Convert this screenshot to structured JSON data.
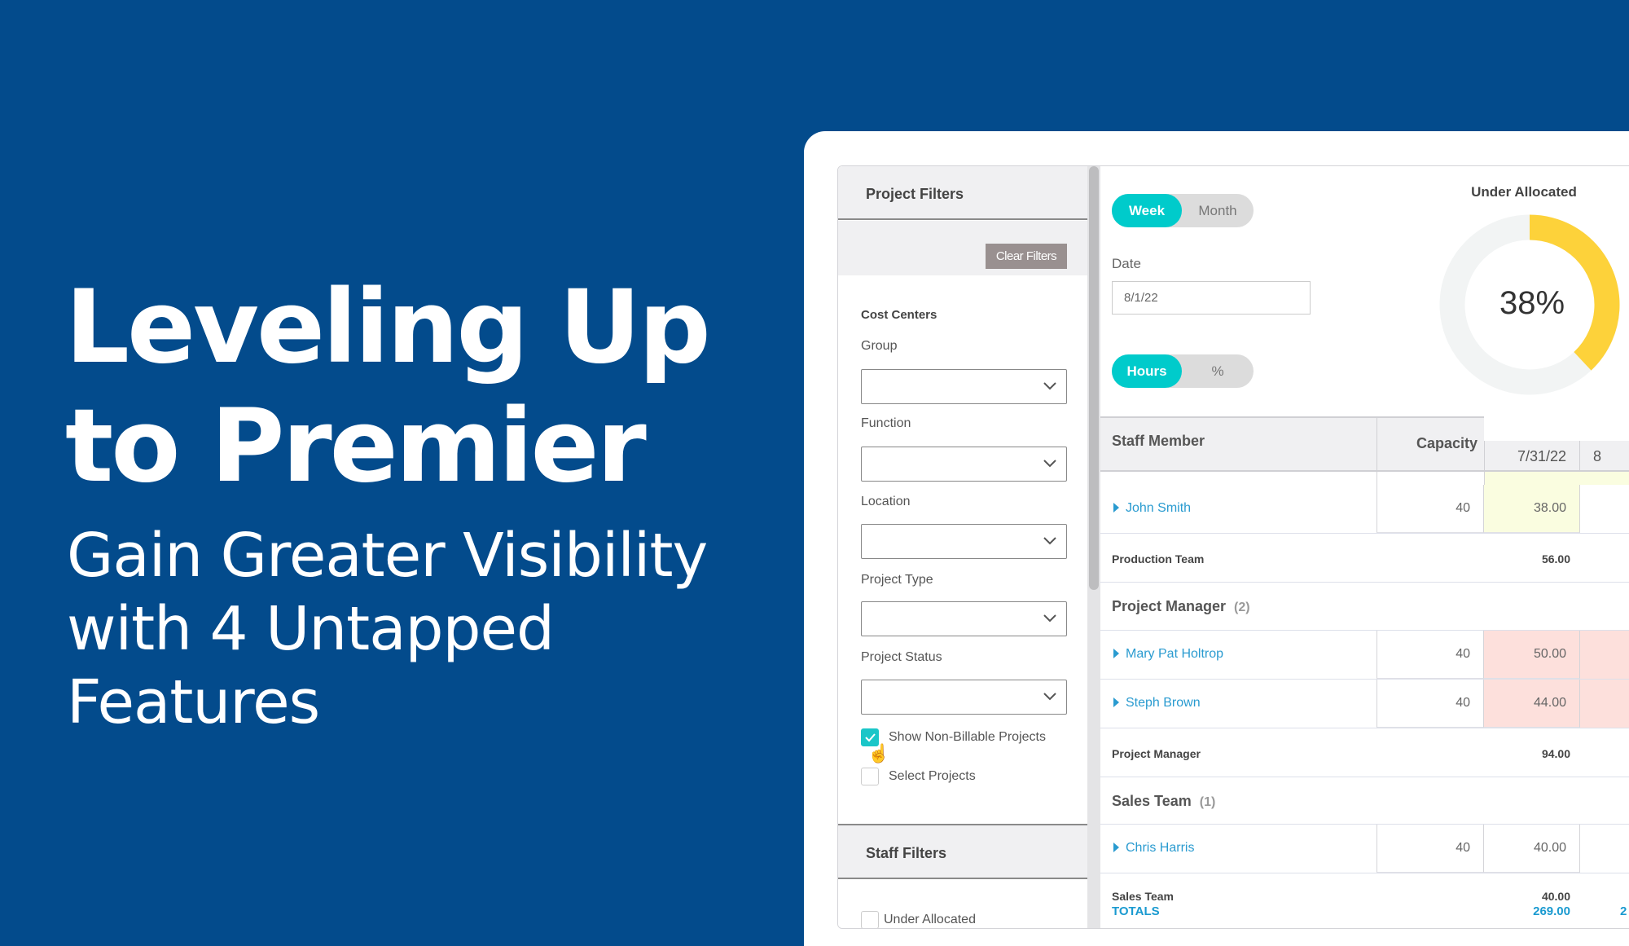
{
  "hero": {
    "title_lines": [
      "Leveling Up",
      "to Premier"
    ],
    "subtitle_lines": [
      "Gain Greater Visibility",
      "with 4 Untapped",
      "Features"
    ]
  },
  "filters": {
    "project_header": "Project Filters",
    "clear_label": "Clear Filters",
    "cost_centers": "Cost Centers",
    "fields": [
      "Group",
      "Function",
      "Location",
      "Project Type",
      "Project Status"
    ],
    "show_non_billable": {
      "label": "Show Non-Billable Projects",
      "checked": true
    },
    "select_projects": {
      "label": "Select Projects",
      "checked": false
    },
    "staff_header": "Staff Filters",
    "under_allocated": {
      "label": "Under Allocated",
      "checked": false
    }
  },
  "controls": {
    "week": "Week",
    "month": "Month",
    "date_label": "Date",
    "date_value": "8/1/22",
    "hours": "Hours",
    "percent": "%"
  },
  "gauge": {
    "title": "Under Allocated",
    "value_label": "38%",
    "percent": 38,
    "color": "#fdd23a",
    "track": "#f2f4f4"
  },
  "table": {
    "headers": {
      "staff": "Staff Member",
      "capacity": "Capacity",
      "date1": "7/31/22",
      "date2": "8"
    },
    "rows": [
      {
        "name": "John Smith",
        "capacity": "40",
        "value": "38.00"
      },
      {
        "subtotal": "Production Team",
        "value": "56.00"
      },
      {
        "group": "Project Manager",
        "count": "(2)"
      },
      {
        "name": "Mary Pat Holtrop",
        "capacity": "40",
        "value": "50.00"
      },
      {
        "name": "Steph Brown",
        "capacity": "40",
        "value": "44.00"
      },
      {
        "subtotal": "Project Manager",
        "value": "94.00"
      },
      {
        "group": "Sales Team",
        "count": "(1)"
      },
      {
        "name": "Chris Harris",
        "capacity": "40",
        "value": "40.00"
      },
      {
        "subtotal": "Sales Team",
        "value": "40.00"
      }
    ],
    "totals": {
      "label": "TOTALS",
      "value": "269.00",
      "next": "2"
    },
    "colors": {
      "under": "#fafde0",
      "over": "#fde0dc",
      "link": "#2a9bd0",
      "accent": "#00cbcb"
    }
  }
}
